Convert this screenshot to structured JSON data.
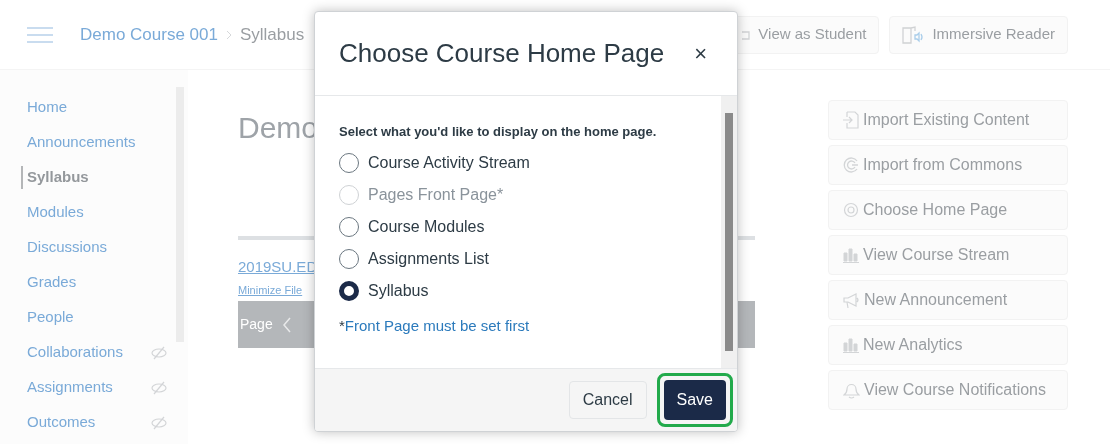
{
  "header": {
    "breadcrumbs": [
      "Demo Course 001",
      "Syllabus"
    ],
    "buttons": [
      {
        "label": "View as Student",
        "kind": "student"
      },
      {
        "label": "Immersive Reader",
        "kind": "reader"
      }
    ]
  },
  "sidebar": {
    "items": [
      {
        "label": "Home",
        "selected": false,
        "hidden_from_students": false
      },
      {
        "label": "Announcements",
        "selected": false,
        "hidden_from_students": false
      },
      {
        "label": "Syllabus",
        "selected": true,
        "hidden_from_students": false
      },
      {
        "label": "Modules",
        "selected": false,
        "hidden_from_students": false
      },
      {
        "label": "Discussions",
        "selected": false,
        "hidden_from_students": false
      },
      {
        "label": "Grades",
        "selected": false,
        "hidden_from_students": false
      },
      {
        "label": "People",
        "selected": false,
        "hidden_from_students": false
      },
      {
        "label": "Collaborations",
        "selected": false,
        "hidden_from_students": true
      },
      {
        "label": "Assignments",
        "selected": false,
        "hidden_from_students": true
      },
      {
        "label": "Outcomes",
        "selected": false,
        "hidden_from_students": true
      }
    ]
  },
  "main": {
    "title": "Demo",
    "file_link": "2019SU.ED",
    "minimize_link": "Minimize File",
    "viewer_page_label": "Page"
  },
  "actions": [
    {
      "label": "Import Existing Content",
      "kind": "import"
    },
    {
      "label": "Import from Commons",
      "kind": "commons"
    },
    {
      "label": "Choose Home Page",
      "kind": "target"
    },
    {
      "label": "View Course Stream",
      "kind": "chart"
    },
    {
      "label": "New Announcement",
      "kind": "megaphone"
    },
    {
      "label": "New Analytics",
      "kind": "chart"
    },
    {
      "label": "View Course Notifications",
      "kind": "bell"
    }
  ],
  "modal": {
    "title": "Choose Course Home Page",
    "close": "×",
    "prompt": "Select what you'd like to display on the home page.",
    "options": [
      {
        "label": "Course Activity Stream",
        "selected": false,
        "disabled": false
      },
      {
        "label": "Pages Front Page*",
        "selected": false,
        "disabled": true
      },
      {
        "label": "Course Modules",
        "selected": false,
        "disabled": false
      },
      {
        "label": "Assignments List",
        "selected": false,
        "disabled": false
      },
      {
        "label": "Syllabus",
        "selected": true,
        "disabled": false
      }
    ],
    "footnote_mark": "*",
    "footnote_link": "Front Page must be set first",
    "cancel": "Cancel",
    "save": "Save",
    "save_focused": true
  }
}
